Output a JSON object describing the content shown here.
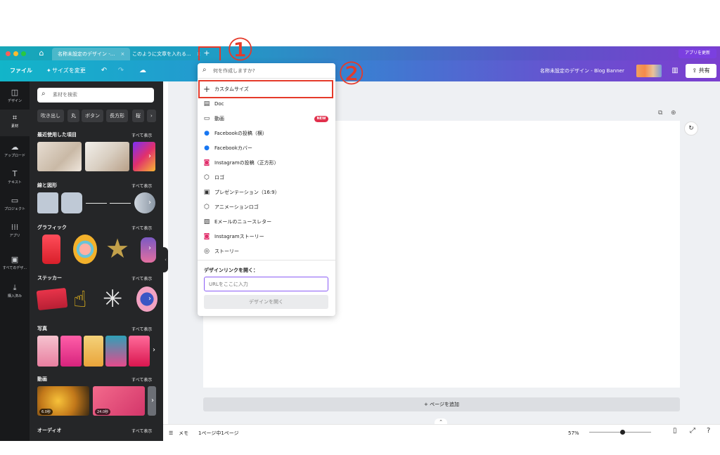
{
  "tabbar": {
    "tab1": "名称未設定のデザイン -...",
    "tab2": "このように文章を入れる...",
    "close": "×",
    "new_tab": "+",
    "update_app": "アプリを更新"
  },
  "toolbar": {
    "file": "ファイル",
    "resize": "サイズを変更",
    "design_title": "名称未設定のデザイン - Blog Banner",
    "share": "共有"
  },
  "rail": [
    {
      "label": "デザイン",
      "icon": "layout-icon"
    },
    {
      "label": "素材",
      "icon": "elements-icon"
    },
    {
      "label": "アップロード",
      "icon": "upload-icon"
    },
    {
      "label": "テキスト",
      "icon": "text-icon"
    },
    {
      "label": "プロジェクト",
      "icon": "folder-icon"
    },
    {
      "label": "アプリ",
      "icon": "apps-icon"
    },
    {
      "label": "すべてのデザ...",
      "icon": "all-designs-icon"
    },
    {
      "label": "購入済み",
      "icon": "download-icon"
    }
  ],
  "panel": {
    "search_placeholder": "素材を検索",
    "chips": [
      "吹き出し",
      "丸",
      "ボタン",
      "長方形",
      "桜"
    ],
    "see_all": "すべて表示",
    "sections": {
      "recent": "最近使用した項目",
      "lines": "線と図形",
      "graphics": "グラフィック",
      "stickers": "ステッカー",
      "photos": "写真",
      "videos": "動画",
      "audio": "オーディオ"
    },
    "video_durations": [
      "6.0秒",
      "24.0秒"
    ]
  },
  "dropdown": {
    "search_placeholder": "何を作成しますか?",
    "items": [
      {
        "label": "カスタムサイズ",
        "icon": "plus-icon"
      },
      {
        "label": "Doc",
        "icon": "doc-icon"
      },
      {
        "label": "動画",
        "icon": "video-icon",
        "badge": "NEW"
      },
      {
        "label": "Facebookの投稿（横）",
        "icon": "facebook-icon"
      },
      {
        "label": "Facebookカバー",
        "icon": "facebook-icon"
      },
      {
        "label": "Instagramの投稿（正方形）",
        "icon": "instagram-icon"
      },
      {
        "label": "ロゴ",
        "icon": "logo-icon"
      },
      {
        "label": "プレゼンテーション（16:9）",
        "icon": "presentation-icon"
      },
      {
        "label": "アニメーションロゴ",
        "icon": "logo-icon"
      },
      {
        "label": "Eメールのニュースレター",
        "icon": "image-icon"
      },
      {
        "label": "Instagramストーリー",
        "icon": "instagram-icon"
      },
      {
        "label": "ストーリー",
        "icon": "story-icon"
      }
    ],
    "link_label": "デザインリンクを開く：",
    "url_placeholder": "URLをここに入力",
    "open_button": "デザインを開く"
  },
  "workspace": {
    "add_page": "+ ページを追加"
  },
  "bottombar": {
    "memo": "メモ",
    "page_info": "1ページ中1ページ",
    "zoom": "57%"
  },
  "annotations": [
    "①",
    "②"
  ],
  "colors": {
    "highlight": "#e53a2a",
    "accent": "#7b3fe0",
    "panel_bg": "#252628"
  }
}
